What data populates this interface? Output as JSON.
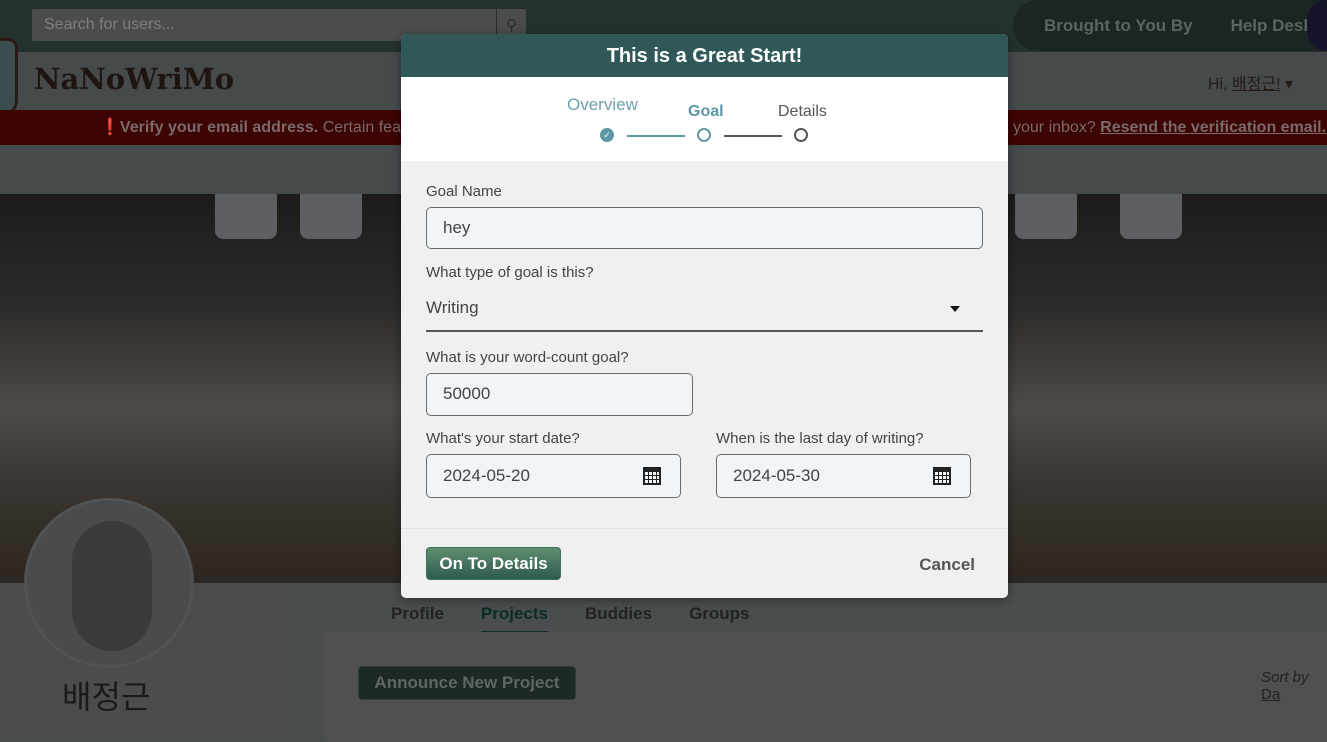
{
  "topbar": {
    "search_placeholder": "Search for users...",
    "links": [
      "Brought to You By",
      "Help Desk"
    ]
  },
  "header": {
    "logo": "NaNoWriMo",
    "greeting": "Hi, ",
    "username_link": "배정근!"
  },
  "banner": {
    "bold": "Verify your email address.",
    "text_left": " Certain featur",
    "text_right": "your inbox? ",
    "link": "Resend the verification email."
  },
  "profile": {
    "name": "배정근",
    "tabs": [
      "Profile",
      "Projects",
      "Buddies",
      "Groups"
    ],
    "active_tab": "Projects",
    "announce_button": "Announce New Project",
    "sort_label": "Sort by",
    "sort_value": "Da"
  },
  "modal": {
    "title": "This is a Great Start!",
    "steps": [
      {
        "label": "Overview",
        "state": "done"
      },
      {
        "label": "Goal",
        "state": "current"
      },
      {
        "label": "Details",
        "state": "pending"
      }
    ],
    "goal_name_label": "Goal Name",
    "goal_name_value": "hey",
    "goal_type_label": "What type of goal is this?",
    "goal_type_value": "Writing",
    "word_count_label": "What is your word-count goal?",
    "word_count_value": "50000",
    "start_date_label": "What's your start date?",
    "start_date_value": "2024-05-20",
    "end_date_label": "When is the last day of writing?",
    "end_date_value": "2024-05-30",
    "next_button": "On To Details",
    "cancel_button": "Cancel"
  },
  "colors": {
    "modal_header": "#305858",
    "step_accent": "#5f97a5",
    "primary_button": "#3f7060"
  }
}
